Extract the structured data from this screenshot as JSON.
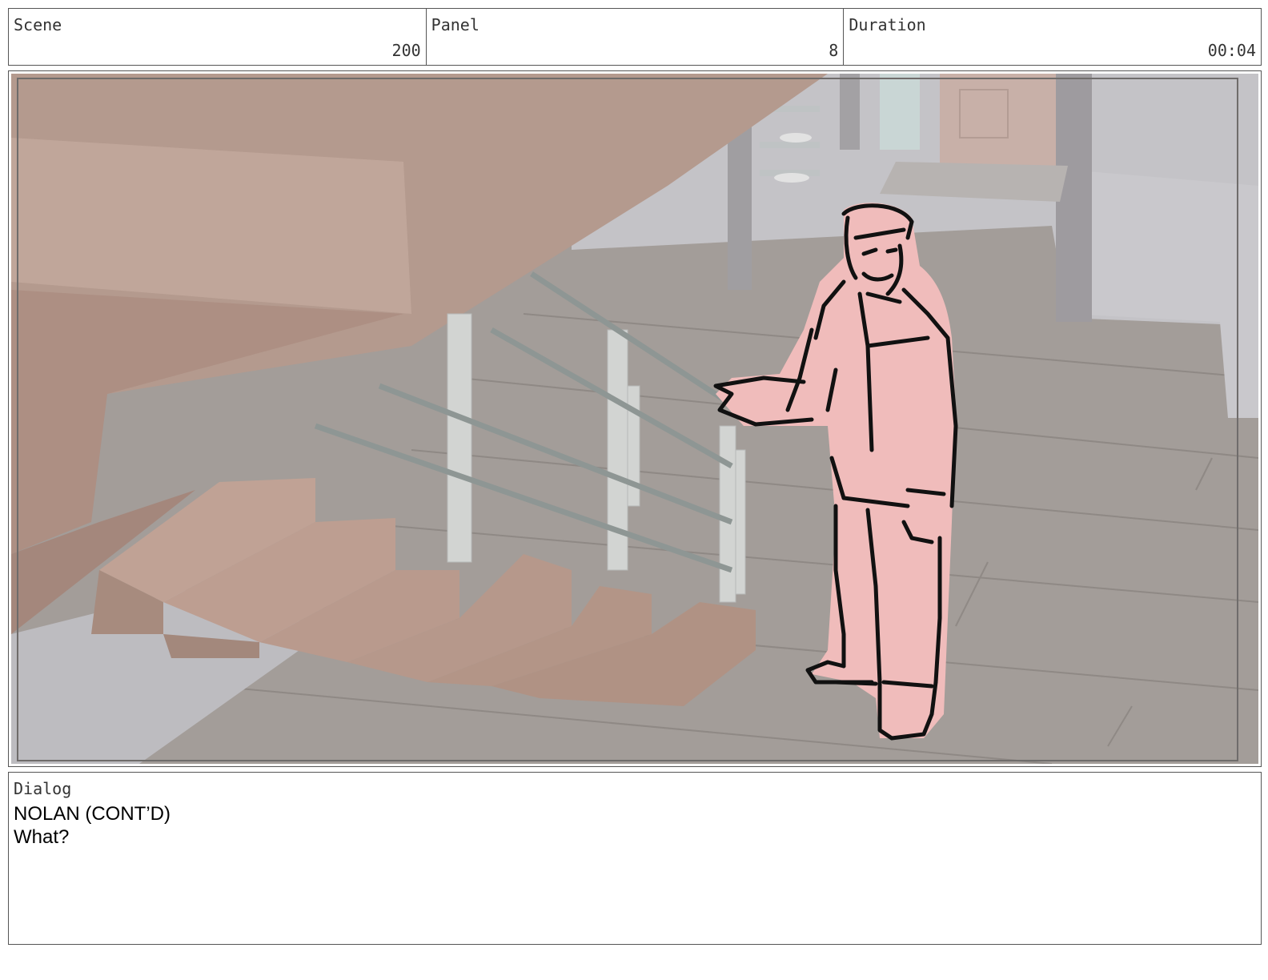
{
  "header": {
    "scene_label": "Scene",
    "scene_value": "200",
    "panel_label": "Panel",
    "panel_value": "8",
    "duration_label": "Duration",
    "duration_value": "00:04"
  },
  "panel": {
    "colors": {
      "floor": "#a39d99",
      "wall": "#c4c3c7",
      "stairs": "#b89a8e",
      "character_fill": "#f0bcbb",
      "outline": "#111111",
      "railing": "#d2d4d2"
    }
  },
  "dialog": {
    "label": "Dialog",
    "character": "NOLAN (CONT’D)",
    "line": "What?"
  }
}
